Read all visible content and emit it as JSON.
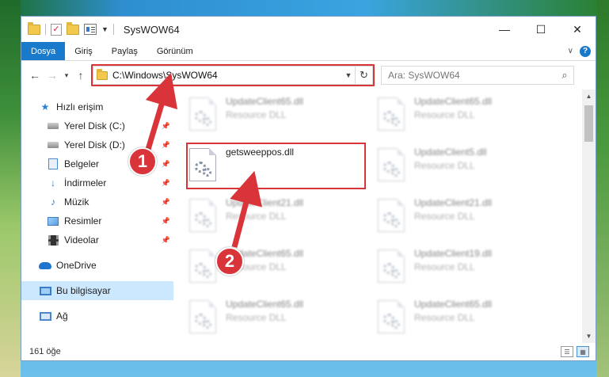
{
  "window": {
    "title": "SysWOW64",
    "controls": {
      "minimize": "—",
      "maximize": "☐",
      "close": "✕"
    }
  },
  "ribbon": {
    "tabs": [
      "Dosya",
      "Giriş",
      "Paylaş",
      "Görünüm"
    ],
    "help": "?"
  },
  "address": {
    "path": "C:\\Windows\\SysWOW64",
    "search_placeholder": "Ara: SysWOW64"
  },
  "sidebar": {
    "quick_access": "Hızlı erişim",
    "items": [
      {
        "label": "Yerel Disk (C:)",
        "icon": "disk-icon"
      },
      {
        "label": "Yerel Disk (D:)",
        "icon": "disk-icon"
      },
      {
        "label": "Belgeler",
        "icon": "document-icon"
      },
      {
        "label": "İndirmeler",
        "icon": "download-icon"
      },
      {
        "label": "Müzik",
        "icon": "music-icon"
      },
      {
        "label": "Resimler",
        "icon": "pictures-icon"
      },
      {
        "label": "Videolar",
        "icon": "videos-icon"
      }
    ],
    "onedrive": "OneDrive",
    "this_pc": "Bu bilgisayar",
    "network": "Ağ"
  },
  "files": {
    "left": [
      {
        "name": "UpdateClient65.dll",
        "type": "Resource DLL"
      },
      {
        "name": "getsweeppos.dll",
        "type": ""
      },
      {
        "name": "UpdateClient21.dll",
        "type": "Resource DLL"
      },
      {
        "name": "UpdateClient65.dll",
        "type": "Resource DLL"
      },
      {
        "name": "UpdateClient65.dll",
        "type": "Resource DLL"
      }
    ],
    "right": [
      {
        "name": "UpdateClient65.dll",
        "type": "Resource DLL"
      },
      {
        "name": "UpdateClient5.dll",
        "type": "Resource DLL"
      },
      {
        "name": "UpdateClient21.dll",
        "type": "Resource DLL"
      },
      {
        "name": "UpdateClient19.dll",
        "type": "Resource DLL"
      },
      {
        "name": "UpdateClient65.dll",
        "type": "Resource DLL"
      }
    ]
  },
  "status": {
    "count": "161 öğe"
  },
  "annotations": {
    "step1": "1",
    "step2": "2",
    "accent": "#d9343a"
  }
}
